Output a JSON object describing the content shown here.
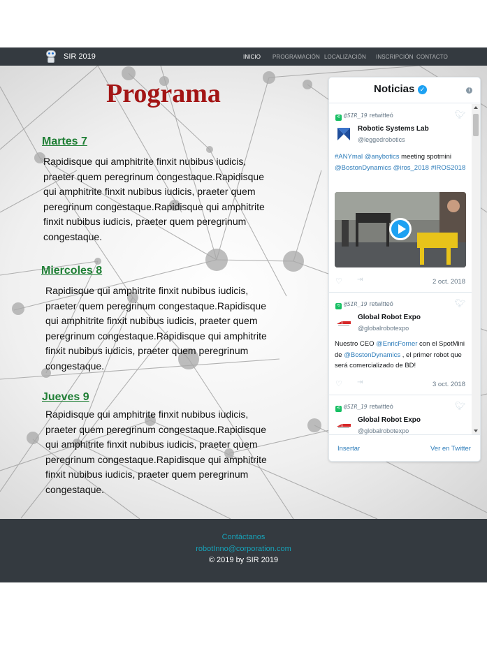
{
  "nav": {
    "brand": "SIR 2019",
    "links": [
      {
        "label": "INICIO",
        "active": true
      },
      {
        "label": "PROGRAMACIÓN",
        "active": false
      },
      {
        "label": "LOCALIZACIÓN",
        "active": false
      },
      {
        "label": "INSCRIPCIÓN",
        "active": false
      },
      {
        "label": "CONTACTO",
        "active": false
      }
    ]
  },
  "main": {
    "title": "Programa",
    "days": [
      {
        "name": "Martes 7",
        "text": "Rapidisque qui amphitrite finxit nubibus iudicis, praeter quem peregrinum congestaque.Rapidisque qui amphitrite finxit nubibus iudicis, praeter quem peregrinum congestaque.Rapidisque qui amphitrite finxit nubibus iudicis, praeter quem peregrinum congestaque."
      },
      {
        "name": "Miercoles 8",
        "text": "Rapidisque qui amphitrite finxit nubibus iudicis, praeter quem peregrinum congestaque.Rapidisque qui amphitrite finxit nubibus iudicis, praeter quem peregrinum congestaque.Rapidisque qui amphitrite finxit nubibus iudicis, praeter quem peregrinum congestaque."
      },
      {
        "name": "Jueves 9",
        "text": "Rapidisque qui amphitrite finxit nubibus iudicis, praeter quem peregrinum congestaque.Rapidisque qui amphitrite finxit nubibus iudicis, praeter quem peregrinum congestaque.Rapidisque qui amphitrite finxit nubibus iudicis, praeter quem peregrinum congestaque."
      }
    ]
  },
  "widget": {
    "title": "Noticias",
    "tweets": [
      {
        "rt_handle": "@SIR_19",
        "rt_label": "retwitteó",
        "author": "Robotic Systems Lab",
        "handle": "@leggedrobotics",
        "text_parts": [
          "#ANYmal",
          " ",
          "@anybotics",
          " meeting spotmini ",
          "@BostonDynamics",
          " ",
          "@iros_2018",
          " ",
          "#IROS2018"
        ],
        "date": "2 oct. 2018"
      },
      {
        "rt_handle": "@SIR_19",
        "rt_label": "retwitteó",
        "author": "Global Robot Expo",
        "handle": "@globalrobotexpo",
        "text_parts": [
          "Nuestro CEO ",
          "@EnricForner",
          " con el SpotMini de ",
          "@BostonDynamics",
          " , el primer robot que será comercializado de BD!"
        ],
        "date": "3 oct. 2018"
      },
      {
        "rt_handle": "@SIR_19",
        "rt_label": "retwitteó",
        "author": "Global Robot Expo",
        "handle": "@globalrobotexpo"
      }
    ],
    "footer": {
      "embed": "Insertar",
      "view": "Ver en Twitter"
    }
  },
  "footer": {
    "contact": "Contáctanos",
    "email": "robotInno@corporation.com",
    "copyright": "© 2019 by SIR 2019"
  },
  "colors": {
    "nav_bg": "#343a40",
    "title": "#a31515",
    "day_heading": "#1e7e34",
    "link": "#2b7bb9",
    "footer_link": "#17a2b8"
  }
}
